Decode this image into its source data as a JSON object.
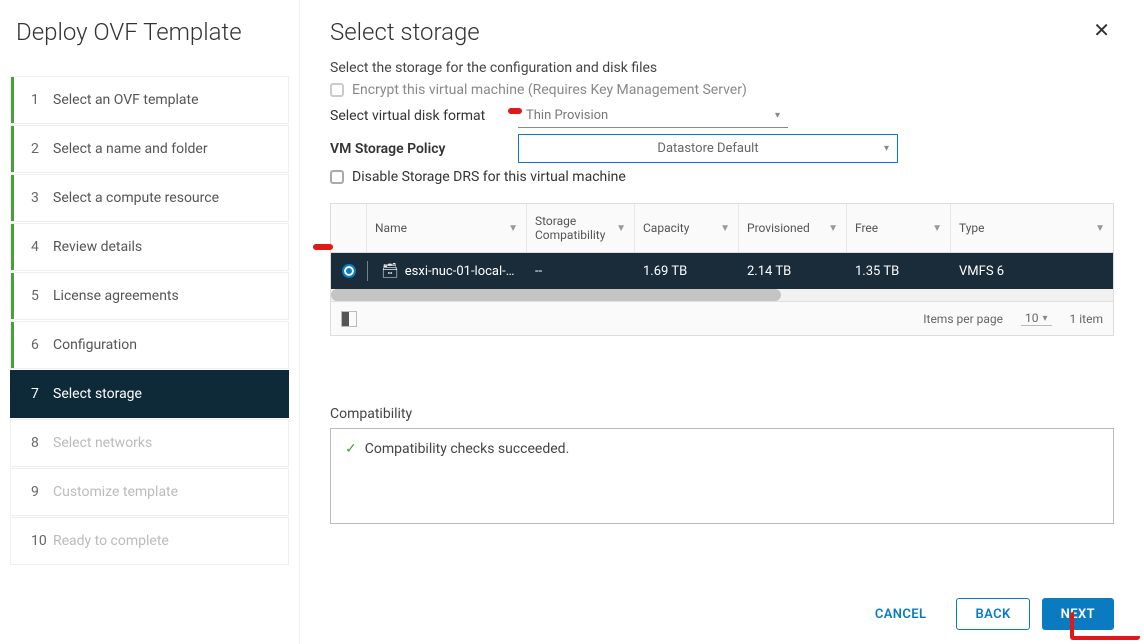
{
  "sidebar": {
    "title": "Deploy OVF Template",
    "steps": [
      {
        "num": "1",
        "label": "Select an OVF template",
        "state": "visited"
      },
      {
        "num": "2",
        "label": "Select a name and folder",
        "state": "visited"
      },
      {
        "num": "3",
        "label": "Select a compute resource",
        "state": "visited"
      },
      {
        "num": "4",
        "label": "Review details",
        "state": "visited"
      },
      {
        "num": "5",
        "label": "License agreements",
        "state": "visited"
      },
      {
        "num": "6",
        "label": "Configuration",
        "state": "visited"
      },
      {
        "num": "7",
        "label": "Select storage",
        "state": "active"
      },
      {
        "num": "8",
        "label": "Select networks",
        "state": "disabled"
      },
      {
        "num": "9",
        "label": "Customize template",
        "state": "disabled"
      },
      {
        "num": "10",
        "label": "Ready to complete",
        "state": "disabled"
      }
    ]
  },
  "main": {
    "title": "Select storage",
    "subtitle": "Select the storage for the configuration and disk files",
    "encrypt_label": "Encrypt this virtual machine (Requires Key Management Server)",
    "disk_format_label": "Select virtual disk format",
    "disk_format_value": "Thin Provision",
    "storage_policy_label": "VM Storage Policy",
    "storage_policy_value": "Datastore Default",
    "disable_drs_label": "Disable Storage DRS for this virtual machine"
  },
  "table": {
    "columns": [
      "Name",
      "Storage Compatibility",
      "Capacity",
      "Provisioned",
      "Free",
      "Type"
    ],
    "rows": [
      {
        "name": "esxi-nuc-01-local-…",
        "storage_compat": "--",
        "capacity": "1.69 TB",
        "provisioned": "2.14 TB",
        "free": "1.35 TB",
        "type": "VMFS 6",
        "selected": true
      }
    ],
    "footer": {
      "items_per_page_label": "Items per page",
      "items_per_page_value": "10",
      "total_items": "1 item"
    }
  },
  "compat": {
    "title": "Compatibility",
    "message": "Compatibility checks succeeded."
  },
  "footer_buttons": {
    "cancel": "CANCEL",
    "back": "BACK",
    "next": "NEXT"
  }
}
